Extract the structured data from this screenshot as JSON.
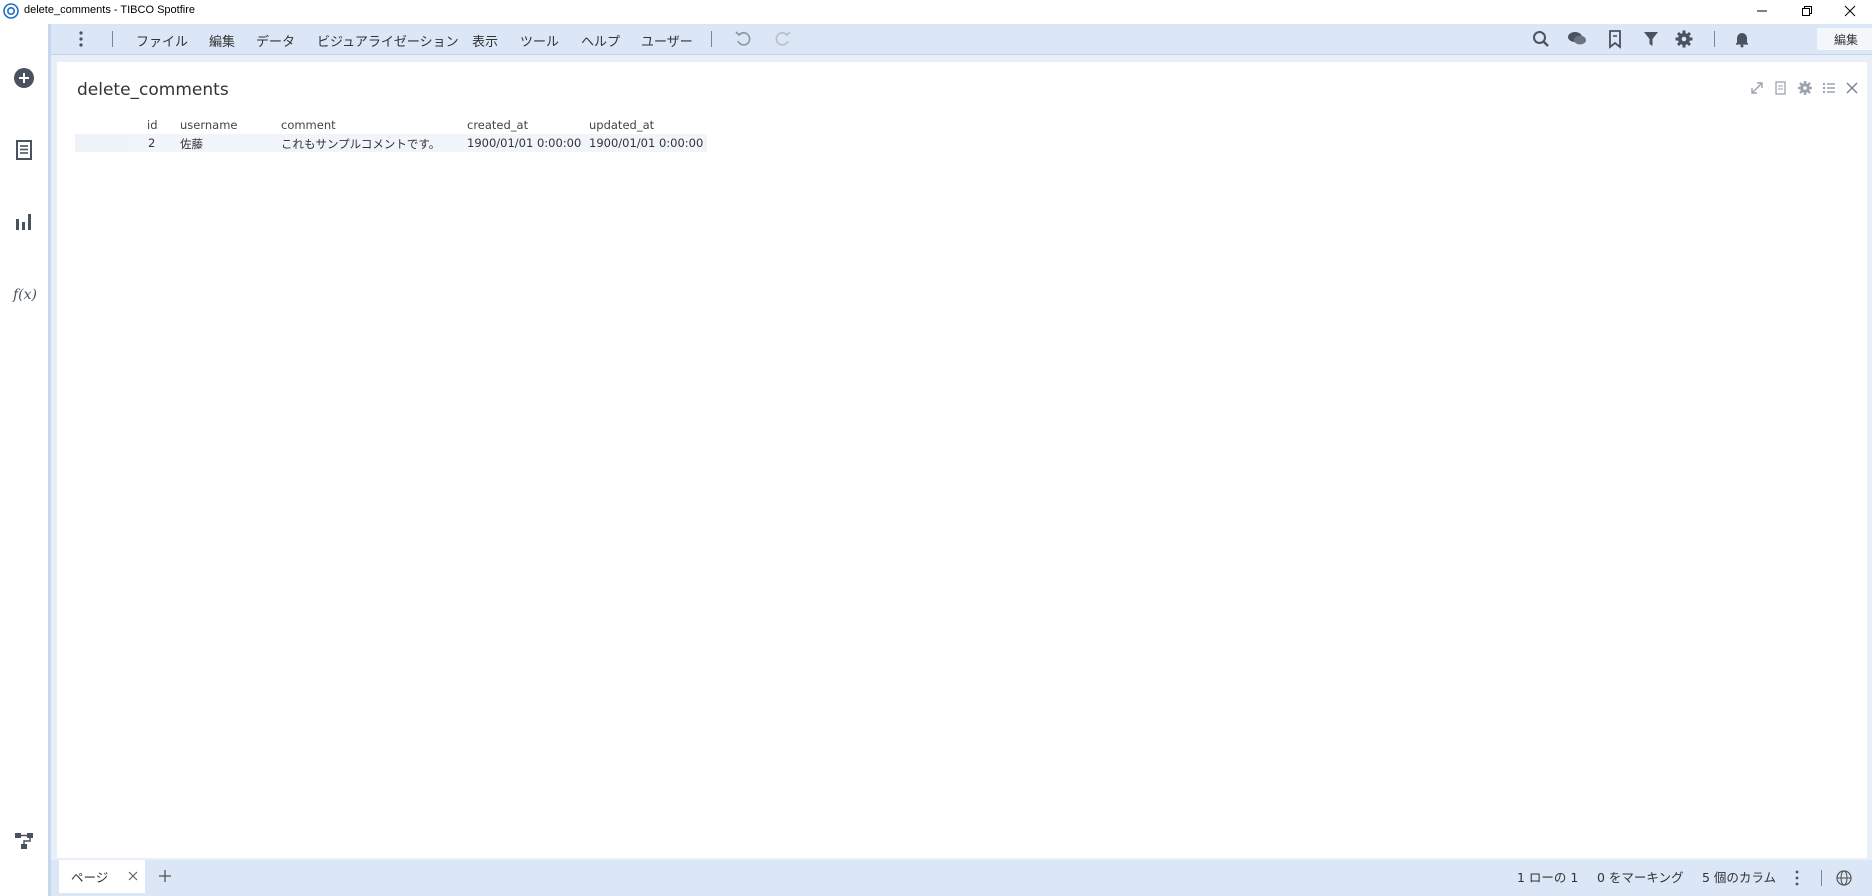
{
  "window": {
    "title": "delete_comments - TIBCO Spotfire"
  },
  "menu": {
    "items": [
      "ファイル",
      "編集",
      "データ",
      "ビジュアライゼーション",
      "表示",
      "ツール",
      "ヘルプ",
      "ユーザー"
    ]
  },
  "mode": {
    "selected": "編集"
  },
  "viz": {
    "title": "delete_comments"
  },
  "table": {
    "columns": [
      "id",
      "username",
      "comment",
      "created_at",
      "updated_at"
    ],
    "rows": [
      [
        "2",
        "佐藤",
        "これもサンプルコメントです。",
        "1900/01/01 0:00:00",
        "1900/01/01 0:00:00"
      ]
    ]
  },
  "pages": {
    "tabs": [
      "ページ"
    ]
  },
  "status": {
    "rows": "1 ローの 1",
    "marking": "0 をマーキング",
    "columns": "5 個のカラム"
  },
  "colors": {
    "accent": "#dbe6f6",
    "icon": "#5a6472"
  }
}
